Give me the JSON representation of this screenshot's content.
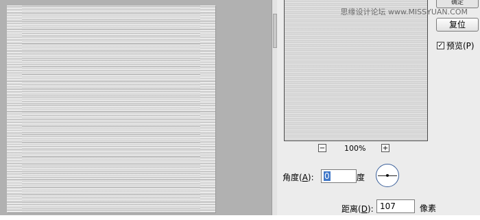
{
  "watermark": "思缘设计论坛 www.MISSYUAN.COM",
  "dialog": {
    "ok_stub": "确定",
    "reset_button": "复位",
    "preview_checkbox": {
      "label": "预览(P)",
      "checked": true
    },
    "zoom": {
      "value": "100%",
      "minus": "−",
      "plus": "+"
    },
    "angle": {
      "label_prefix": "角度(",
      "label_key": "A",
      "label_suffix": "):",
      "value": "0",
      "unit": "度"
    },
    "distance": {
      "label_prefix": "距离(",
      "label_key": "D",
      "label_suffix": "):",
      "value": "107",
      "unit": "像素"
    }
  },
  "icons": {
    "check": "check-icon",
    "angle_dial": "angle-dial-icon"
  }
}
